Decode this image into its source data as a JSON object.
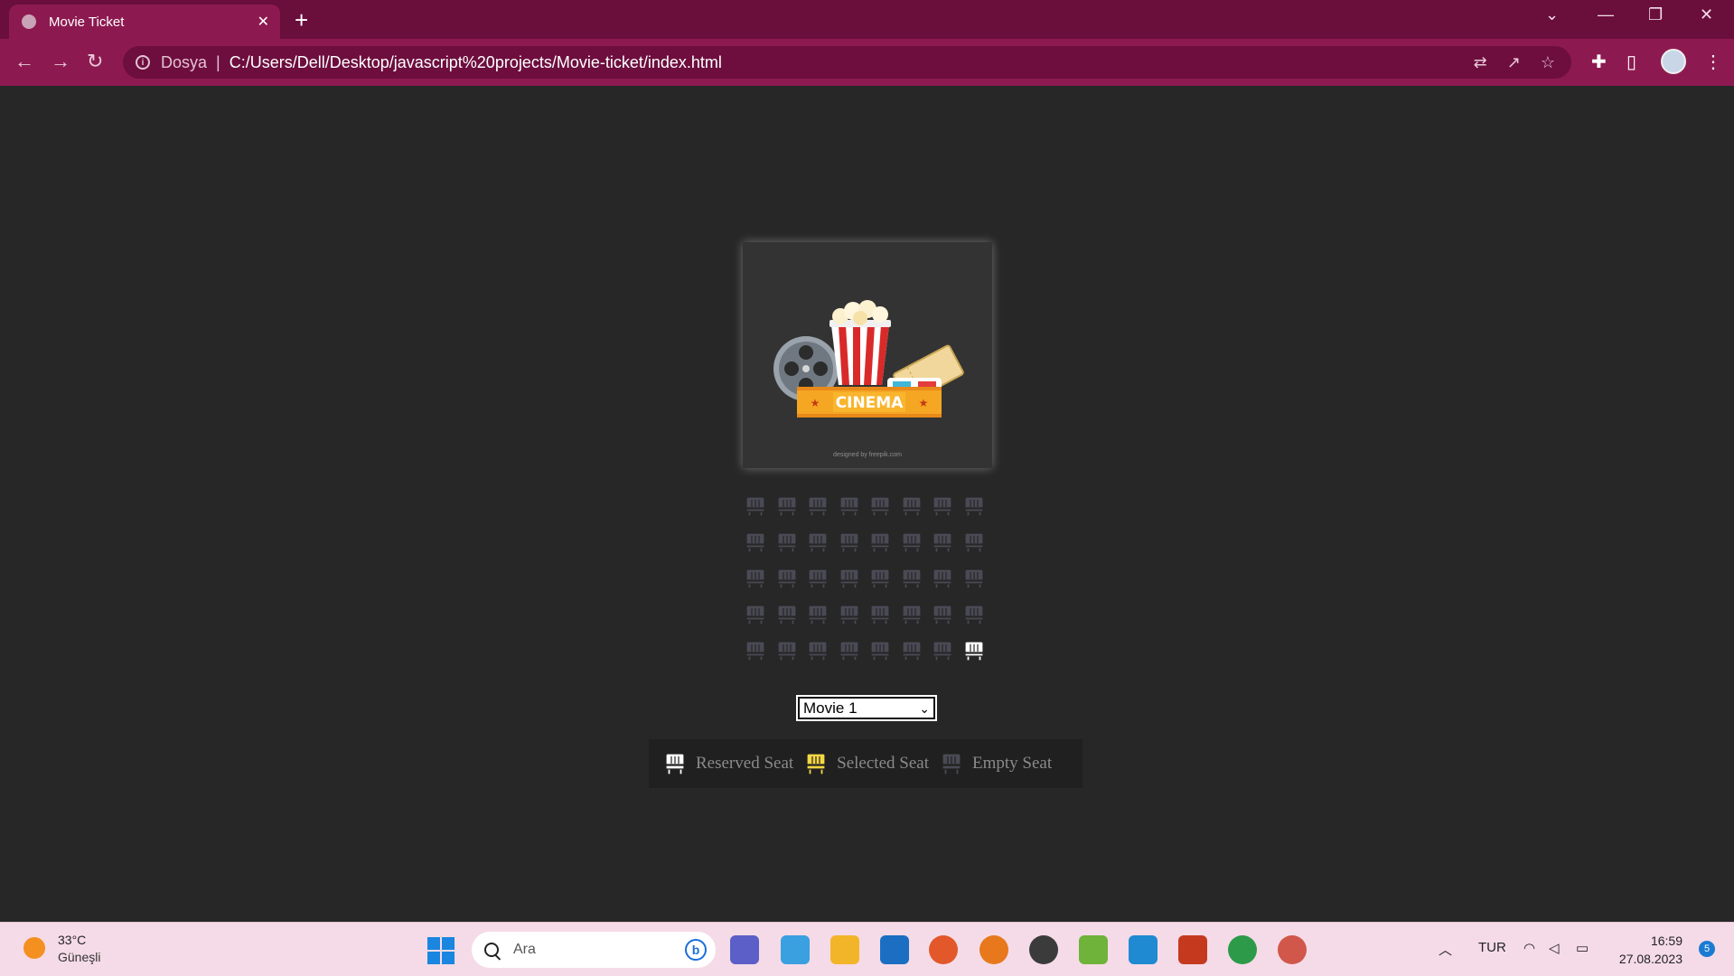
{
  "browser": {
    "tab_title": "Movie Ticket",
    "address_scheme": "Dosya",
    "address_url": "C:/Users/Dell/Desktop/javascript%20projects/Movie-ticket/index.html"
  },
  "poster": {
    "sign_text": "CINEMA",
    "credit": "designed by freepik.com"
  },
  "seats": {
    "rows": 5,
    "cols": 8,
    "reserved": [
      [
        4,
        7
      ]
    ],
    "selected": [],
    "colors": {
      "empty": "#4a4a55",
      "selected": "#f5d742",
      "reserved": "#ffffff"
    }
  },
  "movie_select": {
    "value": "Movie 1"
  },
  "legend": {
    "reserved": "Reserved Seat",
    "selected": "Selected Seat",
    "empty": "Empty Seat"
  },
  "taskbar": {
    "temperature": "33°C",
    "weather": "Güneşli",
    "search_placeholder": "Ara",
    "language": "TUR",
    "time": "16:59",
    "date": "27.08.2023",
    "notifications": "5"
  }
}
